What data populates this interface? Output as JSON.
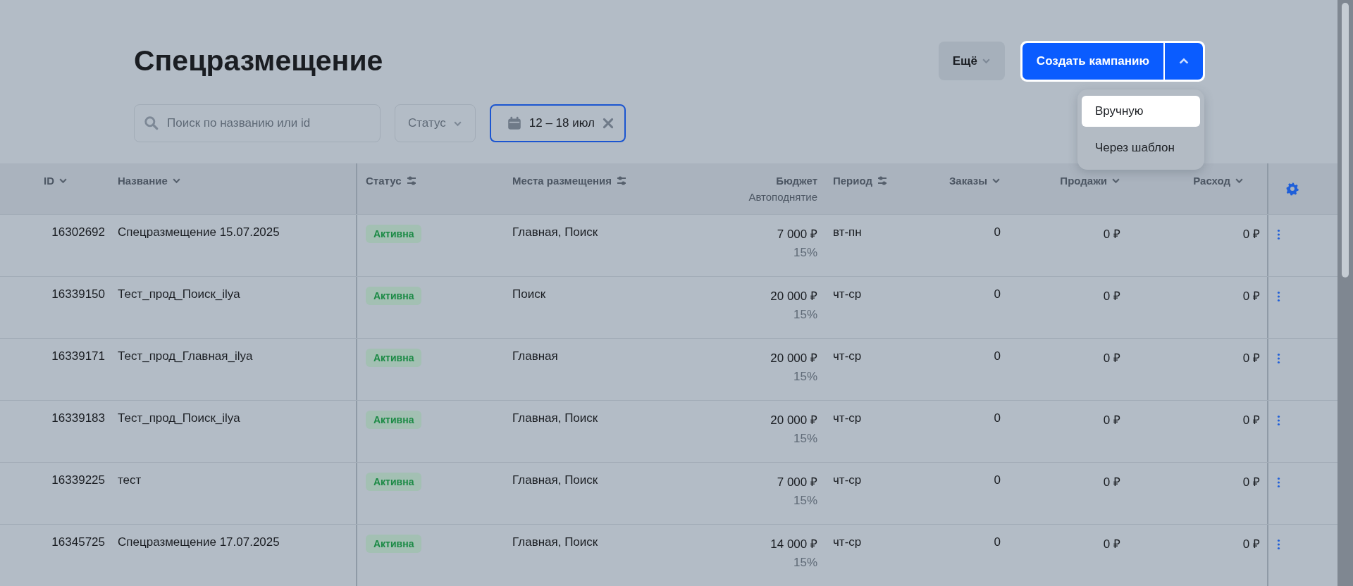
{
  "page_title": "Спецразмещение",
  "more_button": {
    "label": "Ещё"
  },
  "create_button": {
    "label": "Создать кампанию",
    "expanded": true
  },
  "create_menu": [
    {
      "label": "Вручную",
      "selected": true
    },
    {
      "label": "Через шаблон",
      "selected": false
    }
  ],
  "search": {
    "placeholder": "Поиск по названию или id"
  },
  "status_filter": {
    "label": "Статус"
  },
  "date_filter": {
    "value": "12 – 18 июл"
  },
  "table": {
    "columns": [
      {
        "label": "ID",
        "kind": "sort"
      },
      {
        "label": "Название",
        "kind": "sort"
      },
      {
        "label": "Статус",
        "kind": "filter"
      },
      {
        "label": "Места размещения",
        "kind": "filter"
      },
      {
        "label": "Бюджет",
        "sublabel": "Автоподнятие",
        "kind": "plain"
      },
      {
        "label": "Период",
        "kind": "filter"
      },
      {
        "label": "Заказы",
        "kind": "sort"
      },
      {
        "label": "Продажи",
        "kind": "sort"
      },
      {
        "label": "Расход",
        "kind": "sort"
      }
    ],
    "rows": [
      {
        "id": "16302692",
        "name": "Спецразмещение 15.07.2025",
        "status": "Активна",
        "kind": "active",
        "places": "Главная, Поиск",
        "budget": "7 000 ₽",
        "autoraise": "15%",
        "period": "вт-пн",
        "orders": "0",
        "sales": "0 ₽",
        "spend": "0 ₽"
      },
      {
        "id": "16339150",
        "name": "Тест_прод_Поиск_ilya",
        "status": "Активна",
        "kind": "active",
        "places": "Поиск",
        "budget": "20 000 ₽",
        "autoraise": "15%",
        "period": "чт-ср",
        "orders": "0",
        "sales": "0 ₽",
        "spend": "0 ₽"
      },
      {
        "id": "16339171",
        "name": "Тест_прод_Главная_ilya",
        "status": "Активна",
        "kind": "active",
        "places": "Главная",
        "budget": "20 000 ₽",
        "autoraise": "15%",
        "period": "чт-ср",
        "orders": "0",
        "sales": "0 ₽",
        "spend": "0 ₽"
      },
      {
        "id": "16339183",
        "name": "Тест_прод_Поиск_ilya",
        "status": "Активна",
        "kind": "active",
        "places": "Главная, Поиск",
        "budget": "20 000 ₽",
        "autoraise": "15%",
        "period": "чт-ср",
        "orders": "0",
        "sales": "0 ₽",
        "spend": "0 ₽"
      },
      {
        "id": "16339225",
        "name": "тест",
        "status": "Активна",
        "kind": "active",
        "places": "Главная, Поиск",
        "budget": "7 000 ₽",
        "autoraise": "15%",
        "period": "чт-ср",
        "orders": "0",
        "sales": "0 ₽",
        "spend": "0 ₽"
      },
      {
        "id": "16345725",
        "name": "Спецразмещение 17.07.2025",
        "status": "Активна",
        "kind": "active",
        "places": "Главная, Поиск",
        "budget": "14 000 ₽",
        "autoraise": "15%",
        "period": "чт-ср",
        "orders": "0",
        "sales": "0 ₽",
        "spend": "0 ₽"
      }
    ]
  }
}
